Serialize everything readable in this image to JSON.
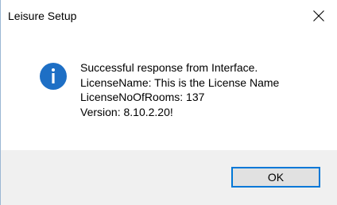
{
  "window": {
    "title": "Leisure Setup"
  },
  "titlebar": {
    "close_icon": "close-icon"
  },
  "message": {
    "icon": "info-icon",
    "lines": [
      "Successful response from Interface.",
      "LicenseName: This is the License Name",
      "LicenseNoOfRooms: 137",
      "Version: 8.10.2.20!"
    ]
  },
  "buttons": {
    "ok_label": "OK"
  },
  "colors": {
    "info_icon_fill": "#1e6fc5",
    "button_border": "#0078d7",
    "button_bg": "#e1e1e1",
    "footer_bg": "#f0f0f0",
    "window_border": "#9bb7d4"
  }
}
